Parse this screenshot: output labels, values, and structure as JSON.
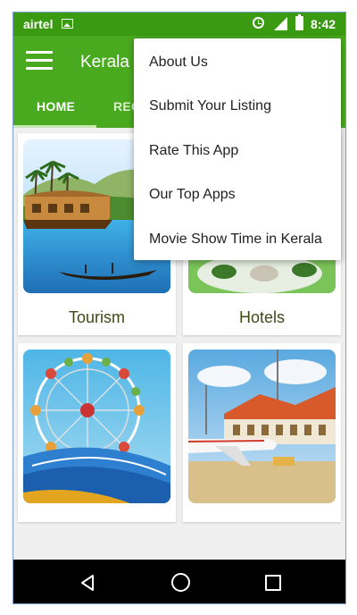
{
  "status_bar": {
    "carrier": "airtel",
    "time": "8:42",
    "icons": [
      "image-icon",
      "alarm-icon",
      "signal-icon",
      "battery-icon"
    ]
  },
  "app_bar": {
    "title": "Kerala",
    "menu_icon": "hamburger-icon",
    "color": "#4aaa1f"
  },
  "tabs": [
    {
      "label": "HOME",
      "selected": true
    },
    {
      "label": "REC",
      "selected": false
    }
  ],
  "cards": [
    {
      "label": "Tourism",
      "image": "houseboat-backwater-photo"
    },
    {
      "label": "Hotels",
      "image": "hotel-food-photo"
    },
    {
      "label": "",
      "image": "ferris-wheel-photo"
    },
    {
      "label": "",
      "image": "airport-airplane-photo"
    }
  ],
  "overflow_menu": {
    "items": [
      "About Us",
      "Submit Your Listing",
      "Rate This App",
      "Our Top Apps",
      "Movie Show Time in Kerala"
    ]
  },
  "nav_bar": {
    "buttons": [
      "back-icon",
      "home-icon",
      "recents-icon"
    ]
  }
}
